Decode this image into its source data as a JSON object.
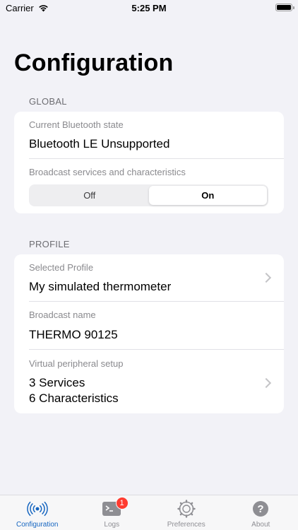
{
  "status_bar": {
    "carrier": "Carrier",
    "time": "5:25 PM"
  },
  "page_title": "Configuration",
  "global": {
    "header": "GLOBAL",
    "bluetooth_state_label": "Current Bluetooth state",
    "bluetooth_state_value": "Bluetooth LE Unsupported",
    "broadcast_label": "Broadcast services and characteristics",
    "broadcast_options": [
      "Off",
      "On"
    ],
    "broadcast_selected": "On"
  },
  "profile": {
    "header": "PROFILE",
    "selected_profile_label": "Selected Profile",
    "selected_profile_value": "My simulated thermometer",
    "broadcast_name_label": "Broadcast name",
    "broadcast_name_value": "THERMO 90125",
    "virtual_setup_label": "Virtual peripheral setup",
    "services_value": "3 Services",
    "characteristics_value": "6 Characteristics"
  },
  "tabs": [
    {
      "label": "Configuration",
      "icon": "broadcast-icon",
      "active": true
    },
    {
      "label": "Logs",
      "icon": "terminal-icon",
      "badge": "1"
    },
    {
      "label": "Preferences",
      "icon": "gear-icon"
    },
    {
      "label": "About",
      "icon": "question-icon"
    }
  ],
  "colors": {
    "accent": "#1565c0",
    "badge": "#ff3b30",
    "background": "#f2f2f7"
  }
}
